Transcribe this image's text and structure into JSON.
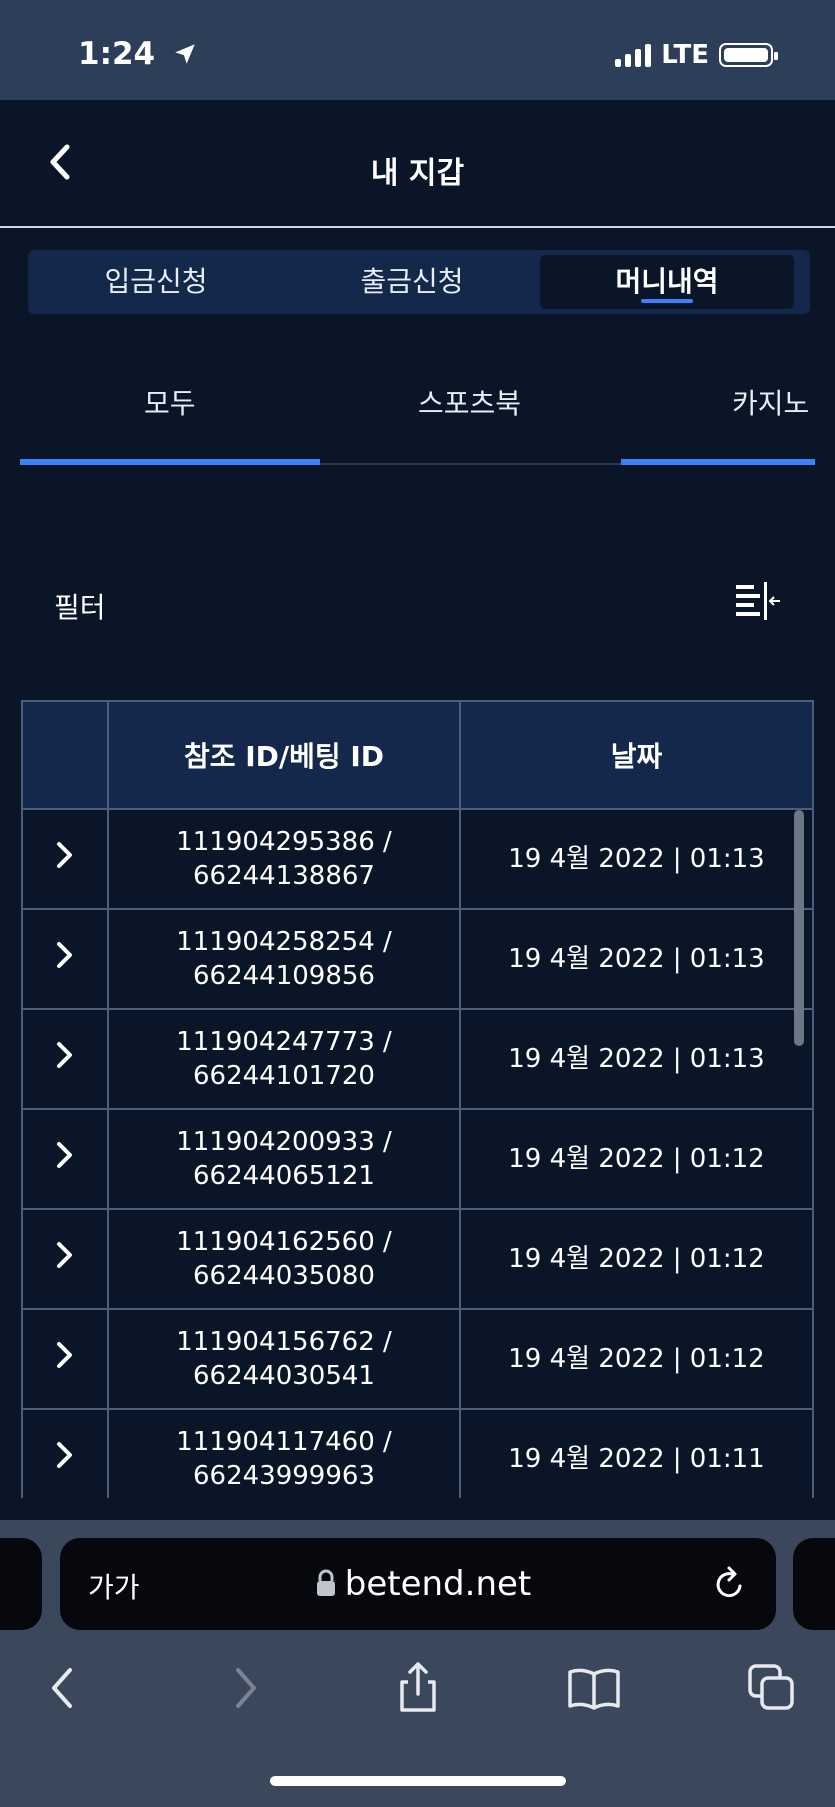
{
  "status": {
    "time": "1:24",
    "network": "LTE"
  },
  "header": {
    "title": "내 지갑"
  },
  "tabs": [
    {
      "label": "입금신청"
    },
    {
      "label": "출금신청"
    },
    {
      "label": "머니내역"
    }
  ],
  "subtabs": [
    {
      "label": "모두"
    },
    {
      "label": "스포츠북"
    },
    {
      "label": "카지노"
    }
  ],
  "filter": {
    "label": "필터"
  },
  "table": {
    "headers": [
      "",
      "참조 ID/베팅 ID",
      "날짜"
    ],
    "rows": [
      {
        "ref": "111904295386 /",
        "bet": "66244138867",
        "date": "19 4월 2022 | 01:13"
      },
      {
        "ref": "111904258254 /",
        "bet": "66244109856",
        "date": "19 4월 2022 | 01:13"
      },
      {
        "ref": "111904247773 /",
        "bet": "66244101720",
        "date": "19 4월 2022 | 01:13"
      },
      {
        "ref": "111904200933 /",
        "bet": "66244065121",
        "date": "19 4월 2022 | 01:12"
      },
      {
        "ref": "111904162560 /",
        "bet": "66244035080",
        "date": "19 4월 2022 | 01:12"
      },
      {
        "ref": "111904156762 /",
        "bet": "66244030541",
        "date": "19 4월 2022 | 01:12"
      },
      {
        "ref": "111904117460 /",
        "bet": "66243999963",
        "date": "19 4월 2022 | 01:11"
      }
    ]
  },
  "browser": {
    "text_size_label": "가가",
    "url": "betend.net"
  },
  "colors": {
    "accent": "#3b82f6",
    "background": "#0a1628",
    "header_bg": "#13284a"
  }
}
